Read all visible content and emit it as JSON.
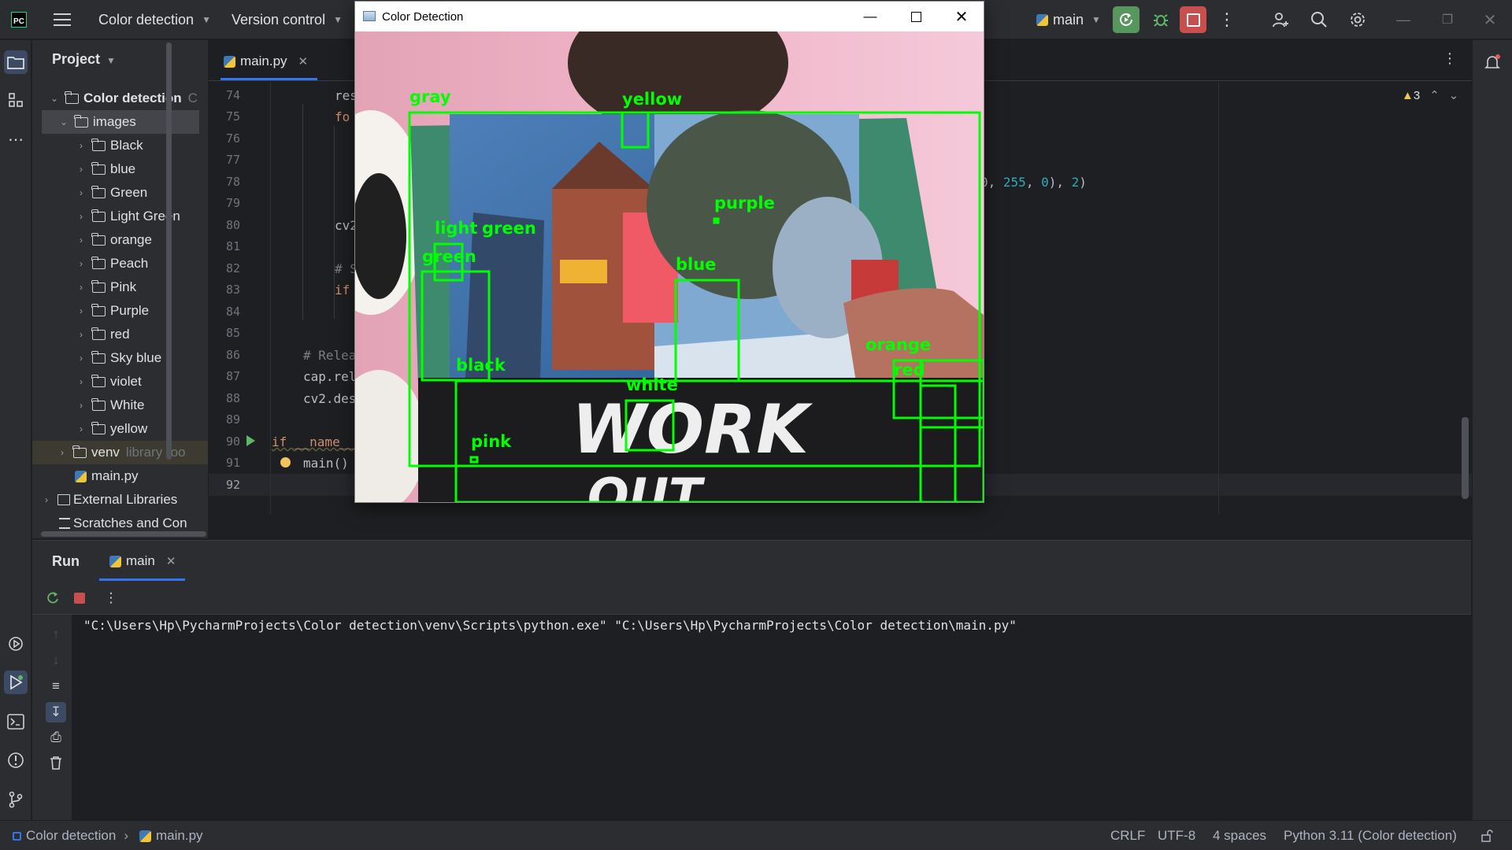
{
  "titlebar": {
    "project_name": "Color detection",
    "vcs_label": "Version control",
    "run_config": "main"
  },
  "project_panel": {
    "title": "Project",
    "root": "Color detection",
    "images_folder": "images",
    "folders": [
      "Black",
      "blue",
      "Green",
      "Light Green",
      "orange",
      "Peach",
      "Pink",
      "Purple",
      "red",
      "Sky blue",
      "violet",
      "White",
      "yellow"
    ],
    "venv": "venv",
    "venv_note": "library roo",
    "main_file": "main.py",
    "external_libraries": "External Libraries",
    "scratches": "Scratches and Con"
  },
  "editor": {
    "tab_label": "main.py",
    "inspection_count": "3",
    "line_numbers": [
      "74",
      "75",
      "76",
      "77",
      "78",
      "79",
      "80",
      "81",
      "82",
      "83",
      "84",
      "85",
      "86",
      "87",
      "88",
      "89",
      "90",
      "91",
      "92"
    ],
    "code": {
      "l74": "res",
      "l75": "fo",
      "l78a": "0, ",
      "l78b": "255",
      "l78c": ", ",
      "l78d": "0",
      "l78e": "), ",
      "l78f": "2",
      "l78g": ")",
      "l80": "cv2",
      "l82": "# S",
      "l83": "if",
      "l86": "# Relea",
      "l87": "cap.rel",
      "l88": "cv2.des",
      "l90": "if __name__",
      "l91": "main()"
    }
  },
  "run_panel": {
    "title": "Run",
    "tab_label": "main",
    "console_output": "\"C:\\Users\\Hp\\PycharmProjects\\Color detection\\venv\\Scripts\\python.exe\" \"C:\\Users\\Hp\\PycharmProjects\\Color detection\\main.py\""
  },
  "statusbar": {
    "project": "Color detection",
    "file": "main.py",
    "line_ending": "CRLF",
    "encoding": "UTF-8",
    "indent": "4 spaces",
    "interpreter": "Python 3.11 (Color detection)"
  },
  "cv_window": {
    "title": "Color Detection",
    "frame_text": "WORK",
    "frame_text2": "OUT",
    "detections": [
      "gray",
      "yellow",
      "purple",
      "light",
      "green",
      "green",
      "blue",
      "black",
      "white",
      "pink",
      "orange",
      "red"
    ]
  },
  "colors": {
    "ide_bg": "#1e1f22",
    "panel_bg": "#2b2d30",
    "accent": "#3574f0",
    "detection_box": "#00ff00"
  }
}
